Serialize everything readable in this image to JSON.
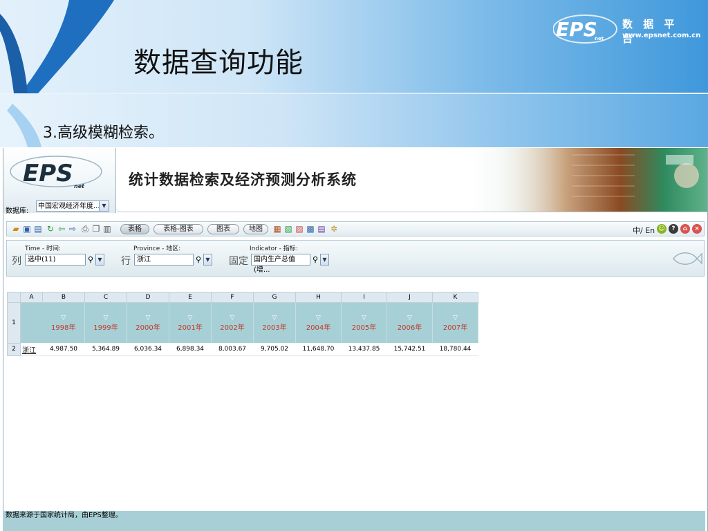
{
  "slide": {
    "title": "数据查询功能",
    "subtitle": "3.高级模糊检索。",
    "logo_text": "EPS",
    "logo_name": "数 据 平 台",
    "logo_url": "www.epsnet.com.cn"
  },
  "app": {
    "logo_text": "EPS",
    "logo_sub": "net",
    "system_title": "统计数据检索及经济预测分析系统",
    "database_label": "数据库:",
    "database_value": "中国宏观经济年度..."
  },
  "toolbar": {
    "buttons": [
      "表格",
      "表格-图表",
      "图表",
      "地图"
    ],
    "lang_label": "中/ En"
  },
  "filter": {
    "time_label": "Time - 时间:",
    "province_label": "Province - 地区:",
    "indicator_label": "Indicator - 指标:",
    "col_label": "列",
    "row_label": "行",
    "fixed_label": "固定",
    "time_value": "选中(11)",
    "province_value": "浙江",
    "indicator_value": "国内生产总值(增..."
  },
  "grid": {
    "col_letters": [
      "A",
      "B",
      "C",
      "D",
      "E",
      "F",
      "G",
      "H",
      "I",
      "J",
      "K"
    ],
    "row_numbers": [
      "1",
      "2"
    ],
    "years": [
      "1998年",
      "1999年",
      "2000年",
      "2001年",
      "2002年",
      "2003年",
      "2004年",
      "2005年",
      "2006年",
      "2007年"
    ],
    "region": "浙江",
    "values": [
      "4,987.50",
      "5,364.89",
      "6,036.34",
      "6,898.34",
      "8,003.67",
      "9,705.02",
      "11,648.70",
      "13,437.85",
      "15,742.51",
      "18,780.44"
    ]
  },
  "footer": {
    "note": "数据来源于国家统计局，由EPS整理。"
  },
  "colors": {
    "year_text": "#c0392b",
    "grid_header": "#a7d0d6",
    "footer_bg": "#a8cfd6"
  }
}
